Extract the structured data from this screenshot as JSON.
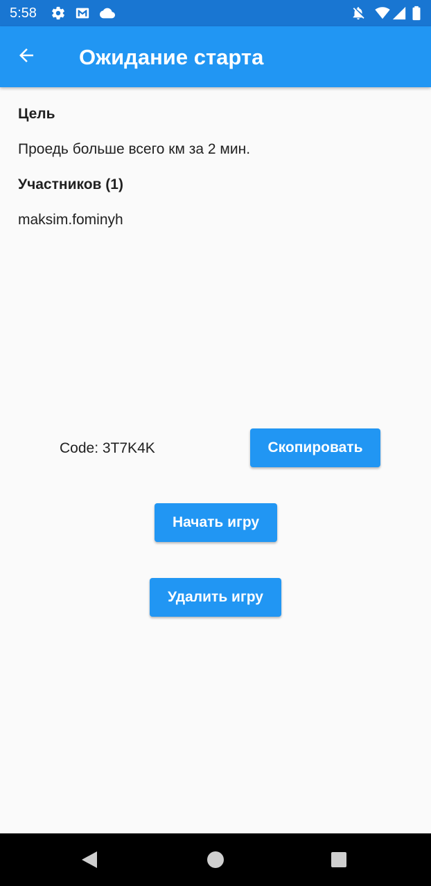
{
  "status_bar": {
    "time": "5:58",
    "left_icons": [
      "gear-icon",
      "gmail-icon",
      "cloud-icon"
    ],
    "right_icons": [
      "notifications-off-icon",
      "wifi-icon",
      "signal-icon",
      "battery-icon"
    ],
    "color": "#1976d2"
  },
  "app_bar": {
    "title": "Ожидание старта",
    "back_icon": "arrow-back-icon",
    "color": "#2196f3"
  },
  "goal": {
    "heading": "Цель",
    "text": "Проедь больше всего км за 2 мин."
  },
  "participants": {
    "heading": "Участников (1)",
    "list": [
      "maksim.fominyh"
    ]
  },
  "code": {
    "label": "Code: 3T7K4K",
    "copy_button": "Скопировать"
  },
  "actions": {
    "start_button": "Начать игру",
    "delete_button": "Удалить игру"
  },
  "nav_bar": {
    "icons": [
      "nav-back-icon",
      "nav-home-icon",
      "nav-recents-icon"
    ]
  },
  "colors": {
    "accent": "#2196f3",
    "status_bar": "#1976d2",
    "background": "#fafafa",
    "text": "#212121"
  }
}
